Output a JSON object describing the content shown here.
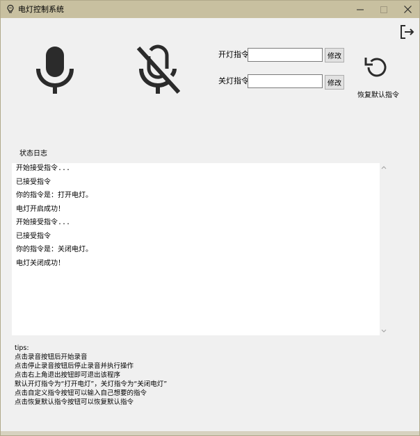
{
  "window": {
    "title": "电灯控制系统"
  },
  "controls": {
    "open_label": "开灯指令",
    "close_label": "关灯指令",
    "open_value": "",
    "close_value": "",
    "modify_label": "修改",
    "restore_label": "恢复默认指令"
  },
  "log": {
    "title": "状态日志",
    "lines": [
      "开始接受指令...",
      "已接受指令",
      "你的指令是：打开电灯。",
      "电灯开启成功！",
      "开始接受指令...",
      "已接受指令",
      "你的指令是：关闭电灯。",
      "电灯关闭成功！"
    ]
  },
  "tips": {
    "heading": "tips:",
    "lines": [
      "点击录音按钮后开始录音",
      "点击停止录音按钮后停止录音并执行操作",
      "点击右上角退出按钮即可退出该程序",
      "默认开灯指令为“打开电灯”，关灯指令为“关闭电灯”",
      "点击自定义指令按钮可以输入自己想要的指令",
      "点击恢复默认指令按钮可以恢复默认指令"
    ]
  },
  "icons": {
    "app": "lightbulb-icon",
    "exit": "exit-icon",
    "mic_on": "microphone-icon",
    "mic_off": "microphone-off-icon",
    "restore": "restore-icon"
  },
  "colors": {
    "titlebar": "#c8c0a0",
    "icon": "#2b2b2b",
    "background": "#f0f0f0"
  }
}
